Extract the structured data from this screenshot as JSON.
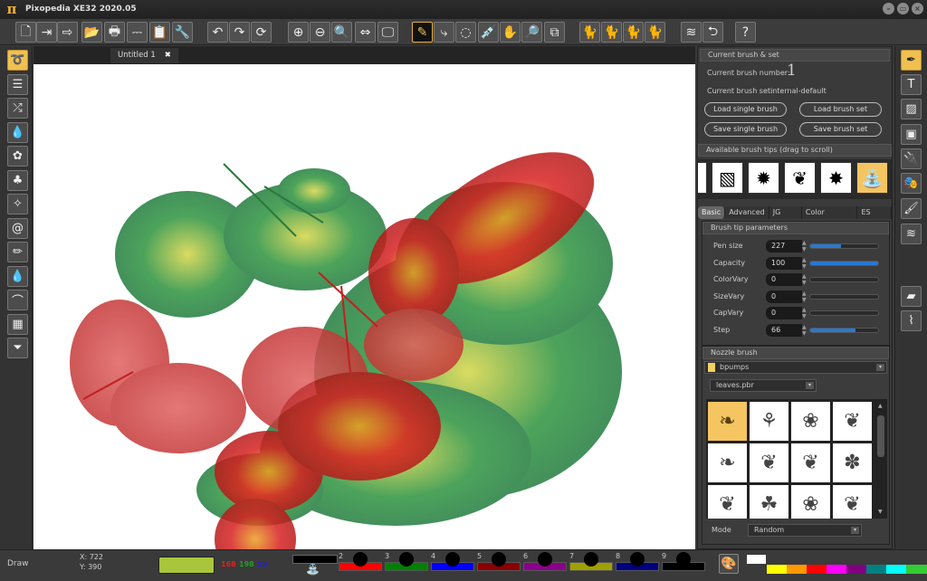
{
  "app": {
    "title": "Pixopedia XE32 2020.05",
    "logo_glyph": "π"
  },
  "window_buttons": [
    {
      "name": "minimize",
      "glyph": "–"
    },
    {
      "name": "maximize",
      "glyph": "▭"
    },
    {
      "name": "close",
      "glyph": "×"
    }
  ],
  "toolbar": [
    {
      "name": "new-file",
      "glyph": "🗋"
    },
    {
      "name": "import",
      "glyph": "⇥"
    },
    {
      "name": "export",
      "glyph": "⇨"
    },
    {
      "name": "open-folder",
      "glyph": "📂"
    },
    {
      "name": "print",
      "glyph": "🖶"
    },
    {
      "name": "scanner",
      "glyph": "⎓"
    },
    {
      "name": "clipboard",
      "glyph": "📋"
    },
    {
      "name": "settings-wrench",
      "glyph": "🔧"
    },
    {
      "name": "undo",
      "glyph": "↶"
    },
    {
      "name": "redo",
      "glyph": "↷"
    },
    {
      "name": "refresh",
      "glyph": "⟳"
    },
    {
      "name": "zoom-in",
      "glyph": "⊕"
    },
    {
      "name": "zoom-out",
      "glyph": "⊖"
    },
    {
      "name": "zoom-fit",
      "glyph": "🔍"
    },
    {
      "name": "fit-screen",
      "glyph": "⇔"
    },
    {
      "name": "monitor",
      "glyph": "🖵"
    },
    {
      "name": "draw-pencil",
      "glyph": "✎",
      "active": true
    },
    {
      "name": "bezier",
      "glyph": "⤷"
    },
    {
      "name": "selection-ellipse",
      "glyph": "◌"
    },
    {
      "name": "eyedropper",
      "glyph": "💉"
    },
    {
      "name": "hand-pan",
      "glyph": "✋"
    },
    {
      "name": "zoom-s",
      "glyph": "🔎"
    },
    {
      "name": "copy-region",
      "glyph": "⧉"
    },
    {
      "name": "cat-1",
      "glyph": "🐈"
    },
    {
      "name": "cat-2",
      "glyph": "🐈"
    },
    {
      "name": "cat-3",
      "glyph": "🐈"
    },
    {
      "name": "cat-4",
      "glyph": "🐈"
    },
    {
      "name": "layers",
      "glyph": "≋"
    },
    {
      "name": "back",
      "glyph": "⮌"
    },
    {
      "name": "help",
      "glyph": "?"
    }
  ],
  "left_tools": [
    {
      "name": "brush-tool",
      "glyph": "➰",
      "active": true
    },
    {
      "name": "adjust-sliders",
      "glyph": "☰"
    },
    {
      "name": "shuffle",
      "glyph": "⤮"
    },
    {
      "name": "drop-3",
      "glyph": "💧"
    },
    {
      "name": "flower",
      "glyph": "✿"
    },
    {
      "name": "tree",
      "glyph": "♣"
    },
    {
      "name": "magic-wand",
      "glyph": "✧"
    },
    {
      "name": "spiral",
      "glyph": "@"
    },
    {
      "name": "pencil",
      "glyph": "✏"
    },
    {
      "name": "drop-gear",
      "glyph": "💧"
    },
    {
      "name": "rainbow",
      "glyph": "⌒"
    },
    {
      "name": "grid",
      "glyph": "▦"
    },
    {
      "name": "filter-funnel",
      "glyph": "⏷"
    }
  ],
  "right_tools": [
    {
      "name": "paint-brush",
      "glyph": "✒",
      "active": true
    },
    {
      "name": "text",
      "glyph": "T"
    },
    {
      "name": "image-frame",
      "glyph": "▨"
    },
    {
      "name": "image",
      "glyph": "▣"
    },
    {
      "name": "plugin",
      "glyph": "🔌"
    },
    {
      "name": "masks",
      "glyph": "🎭"
    },
    {
      "name": "broom-brush",
      "glyph": "🖌"
    },
    {
      "name": "layers-stack",
      "glyph": "≋"
    },
    {
      "name": "gradient-flag",
      "glyph": "▰"
    },
    {
      "name": "curve-graph",
      "glyph": "⌇"
    }
  ],
  "document": {
    "tab_label": "Untitled 1",
    "close_glyph": "✖"
  },
  "panel": {
    "current_section": "Current brush & set",
    "brush_number_label": "Current brush number:",
    "brush_number": "1",
    "brush_set_label": "Current brush set:",
    "brush_set": "internal-default",
    "buttons": [
      "Load single brush",
      "Load brush set",
      "Save single brush",
      "Save brush set"
    ],
    "tips_section": "Available brush tips (drag to scroll)",
    "tips": [
      {
        "glyph": "✺"
      },
      {
        "glyph": "▧"
      },
      {
        "glyph": "✹"
      },
      {
        "glyph": "❦"
      },
      {
        "glyph": "✸"
      },
      {
        "glyph": "⛲",
        "selected": true
      }
    ],
    "tabs": [
      {
        "label": "Basic",
        "active": true
      },
      {
        "label": "Advanced"
      },
      {
        "label": "JG rules"
      },
      {
        "label": "Color sceheme"
      },
      {
        "label": "ES rules"
      }
    ],
    "params_section": "Brush tip parameters",
    "params": [
      {
        "label": "Pen size",
        "value": "227",
        "fill": 0.45
      },
      {
        "label": "Capacity",
        "value": "100",
        "fill": 1.0
      },
      {
        "label": "ColorVary",
        "value": "0",
        "fill": 0
      },
      {
        "label": "SizeVary",
        "value": "0",
        "fill": 0
      },
      {
        "label": "CapVary",
        "value": "0",
        "fill": 0
      },
      {
        "label": "Step",
        "value": "66",
        "fill": 0.66
      }
    ],
    "nozzle_section": "Nozzle brush",
    "nozzle_folder": "bpumps",
    "nozzle_file": "leaves.pbr",
    "nozzle_cells": [
      "❧",
      "⚘",
      "❀",
      "❦",
      "❧",
      "❦",
      "❦",
      "✽",
      "❦",
      "☘",
      "❀",
      "❦"
    ],
    "mode_label": "Mode",
    "mode_value": "Random"
  },
  "status": {
    "mode": "Draw",
    "x": "X: 722",
    "y": "Y: 390",
    "color_hex": "#a8c63b",
    "r": "168",
    "g": "198",
    "b": "59",
    "slots": [
      {
        "num": "2",
        "color": "#ff0000"
      },
      {
        "num": "3",
        "color": "#008000"
      },
      {
        "num": "4",
        "color": "#0000ff"
      },
      {
        "num": "5",
        "color": "#8b0000"
      },
      {
        "num": "6",
        "color": "#8b008b"
      },
      {
        "num": "7",
        "color": "#a0a000"
      },
      {
        "num": "8",
        "color": "#000080"
      },
      {
        "num": "9",
        "color": "#000000"
      }
    ],
    "palette_icon": "🎨",
    "palette": [
      "#ffff00",
      "#ff9900",
      "#ff0000",
      "#ff00ff",
      "#800080",
      "#008080",
      "#00ffff",
      "#33cc33"
    ]
  }
}
